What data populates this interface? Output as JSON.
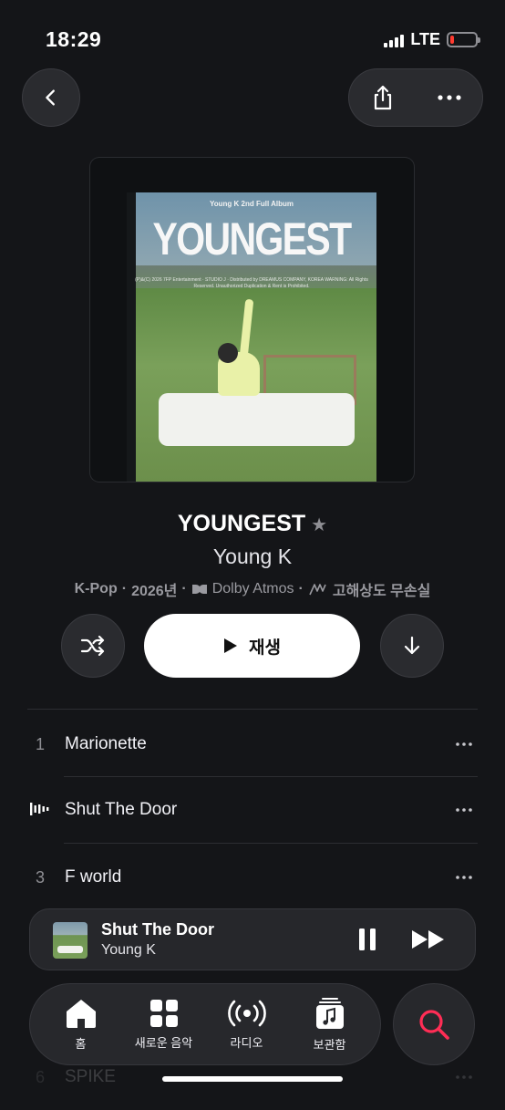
{
  "status_bar": {
    "time": "18:29",
    "network": "LTE",
    "battery_level": 0.12
  },
  "header": {
    "back_icon": "chevron-left-icon",
    "share_icon": "share-icon",
    "more_icon": "ellipsis-icon"
  },
  "artwork": {
    "subtitle": "Young K 2nd Full Album",
    "title": "YOUNGEST",
    "fine_print": "(P)&(C) 2026 7FP Entertainment · STUDIO J · Distributed by DREAMUS COMPANY, KOREA WARNING: All Rights Reserved. Unauthorized Duplication & Rent is Prohibited."
  },
  "album": {
    "title": "YOUNGEST",
    "artist": "Young K",
    "genre": "K-Pop",
    "year": "2026년",
    "dolby": "Dolby Atmos",
    "lossless": "고해상도 무손실",
    "separator": "·"
  },
  "controls": {
    "play_label": "재생"
  },
  "tracks": [
    {
      "num": "1",
      "name": "Marionette",
      "playing": false
    },
    {
      "num": "2",
      "name": "Shut The Door",
      "playing": true
    },
    {
      "num": "3",
      "name": "F world",
      "playing": false
    },
    {
      "num": "6",
      "name": "SPIKE",
      "playing": false
    }
  ],
  "mini_player": {
    "title": "Shut The Door",
    "artist": "Young K"
  },
  "tab_bar": {
    "tabs": [
      {
        "label": "홈",
        "icon": "home-icon"
      },
      {
        "label": "새로운 음악",
        "icon": "grid-icon"
      },
      {
        "label": "라디오",
        "icon": "radio-icon"
      },
      {
        "label": "보관함",
        "icon": "library-icon"
      }
    ],
    "search_icon": "search-icon"
  },
  "colors": {
    "background": "#141518",
    "accent": "#ff2d55",
    "button": "#2a2b2f"
  }
}
